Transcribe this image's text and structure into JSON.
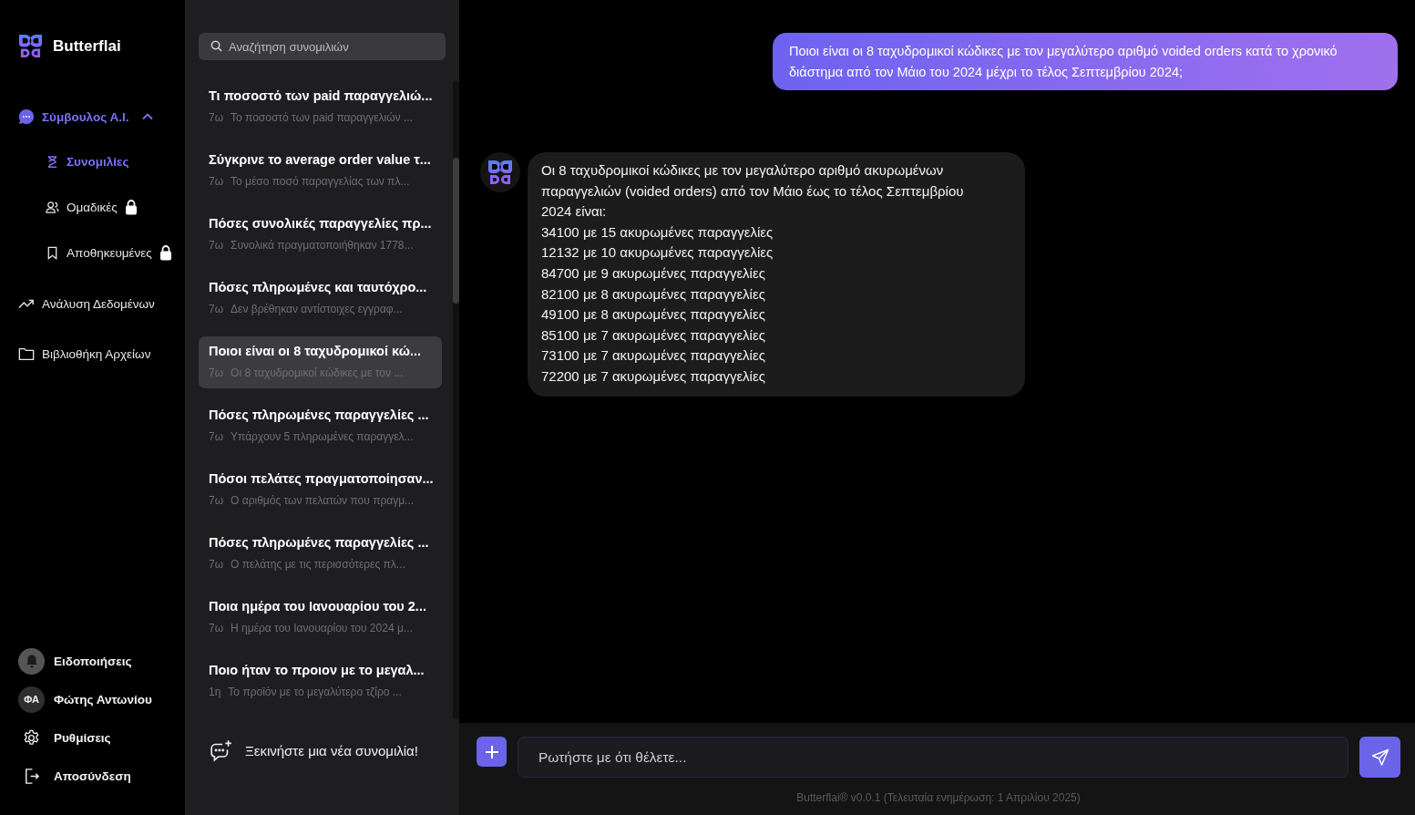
{
  "brand": {
    "name": "Butterflai"
  },
  "nav": [
    {
      "label": "Σύμβουλος Α.Ι.",
      "kind": "chat",
      "selected": true,
      "expanded": true,
      "children": [
        {
          "label": "Συνομιλίες",
          "kind": "hourglass",
          "selected": true,
          "locked": false
        },
        {
          "label": "Ομαδικές",
          "kind": "users",
          "selected": false,
          "locked": true
        },
        {
          "label": "Αποθηκευμένες",
          "kind": "bookmark",
          "selected": false,
          "locked": true
        }
      ]
    },
    {
      "label": "Ανάλυση Δεδομένων",
      "kind": "trend",
      "selected": false
    },
    {
      "label": "Βιβλιοθήκη Αρχείων",
      "kind": "folder",
      "selected": false
    }
  ],
  "account": [
    {
      "kind": "notifications",
      "label": "Ειδοποιήσεις"
    },
    {
      "kind": "user",
      "initials": "ΦΑ",
      "label": "Φώτης Αντωνίου"
    },
    {
      "kind": "settings",
      "label": "Ρυθμίσεις"
    },
    {
      "kind": "logout",
      "label": "Αποσύνδεση"
    }
  ],
  "search": {
    "placeholder": "Αναζήτηση συνομιλιών"
  },
  "conversations": [
    {
      "title": "Τι ποσοστό των paid παραγγελιώ...",
      "age": "7ω",
      "preview": "Το ποσοστό των paid παραγγελιών ...",
      "selected": false
    },
    {
      "title": "Σύγκρινε το average order value τ...",
      "age": "7ω",
      "preview": "Το μέσο ποσό παραγγελίας των πλ...",
      "selected": false
    },
    {
      "title": "Πόσες συνολικές παραγγελίες πρ...",
      "age": "7ω",
      "preview": "Συνολικά πραγματοποιήθηκαν 1778...",
      "selected": false
    },
    {
      "title": "Πόσες πληρωμένες και ταυτόχρο...",
      "age": "7ω",
      "preview": "Δεν βρέθηκαν αντίστοιχες εγγραφ...",
      "selected": false
    },
    {
      "title": "Ποιοι είναι οι 8 ταχυδρομικοί κώ...",
      "age": "7ω",
      "preview": "Οι 8 ταχυδρομικοί κώδικες με τον ...",
      "selected": true
    },
    {
      "title": "Πόσες πληρωμένες παραγγελίες ...",
      "age": "7ω",
      "preview": "Υπάρχουν 5 πληρωμένες παραγγελ...",
      "selected": false
    },
    {
      "title": "Πόσοι πελάτες πραγματοποίησαν...",
      "age": "7ω",
      "preview": "Ο αριθμός των πελατών που πραγμ...",
      "selected": false
    },
    {
      "title": "Πόσες πληρωμένες παραγγελίες ...",
      "age": "7ω",
      "preview": "Ο πελάτης με τις περισσότερες πλ...",
      "selected": false
    },
    {
      "title": "Ποια ημέρα του Ιανουαρίου του 2...",
      "age": "7ω",
      "preview": "Η ημέρα του Ιανουαρίου του 2024 μ...",
      "selected": false
    },
    {
      "title": "Ποιο ήταν το προιον με το μεγαλ...",
      "age": "1η",
      "preview": "Το προϊόν με το μεγαλύτερο τζίρο ...",
      "selected": false
    }
  ],
  "new_conversation": {
    "label": "Ξεκινήστε μια νέα συνομιλία!"
  },
  "messages": [
    {
      "kind": "user",
      "text": "Ποιοι είναι οι 8 ταχυδρομικοί κώδικες με τον μεγαλύτερο αριθμό voided orders κατά το χρονικό διάστημα από τον Μάιο του 2024 μέχρι το τέλος Σεπτεμβρίου 2024;"
    },
    {
      "kind": "assistant",
      "intro": "Οι 8 ταχυδρομικοί κώδικες με τον μεγαλύτερο αριθμό ακυρωμένων παραγγελιών (voided orders) από τον Μάιο έως το τέλος Σεπτεμβρίου 2024 είναι:",
      "lines": [
        "34100 με 15 ακυρωμένες παραγγελίες",
        "12132 με 10 ακυρωμένες παραγγελίες",
        "84700 με 9 ακυρωμένες παραγγελίες",
        "82100 με 8 ακυρωμένες παραγγελίες",
        "49100 με 8 ακυρωμένες παραγγελίες",
        "85100 με 7 ακυρωμένες παραγγελίες",
        "73100 με 7 ακυρωμένες παραγγελίες",
        "72200 με 7 ακυρωμένες παραγγελίες"
      ]
    }
  ],
  "composer": {
    "placeholder": "Ρωτήστε με ότι θέλετε..."
  },
  "footer": "Butterflai® v0.0.1 (Τελευταία ενημέρωση: 1 Απριλίου 2025)"
}
